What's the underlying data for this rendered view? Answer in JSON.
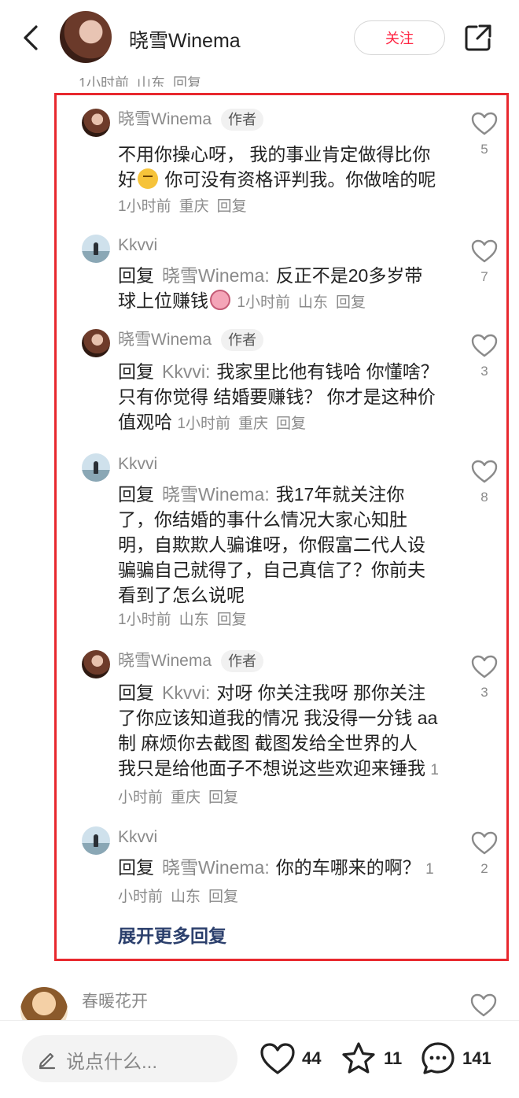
{
  "header": {
    "back_icon": "chevron-left-icon",
    "user_name": "晓雪Winema",
    "follow_label": "关注",
    "share_icon": "share-icon"
  },
  "previous_comment_meta": {
    "time": "1小时前",
    "location": "山东",
    "reply": "回复"
  },
  "replies": [
    {
      "name": "晓雪Winema",
      "tag": "作者",
      "prefix": "",
      "target": "",
      "text": "不用你操心呀， 我的事业肯定做得比你好",
      "emoji": "thinking-face-icon",
      "text_after": " 你可没有资格评判我。你做啥的呢",
      "time": "1小时前",
      "location": "重庆",
      "reply": "回复",
      "likes": "5"
    },
    {
      "name": "Kkvvi",
      "tag": "",
      "prefix": "回复",
      "target": "晓雪Winema",
      "text": "反正不是20多岁带球上位赚钱",
      "emoji": "sweat-face-icon",
      "text_after": "",
      "time": "1小时前",
      "location": "山东",
      "reply": "回复",
      "likes": "7"
    },
    {
      "name": "晓雪Winema",
      "tag": "作者",
      "prefix": "回复",
      "target": "Kkvvi",
      "text": "我家里比他有钱哈 你懂啥？ 只有你觉得 结婚要赚钱？ 你才是这种价值观哈",
      "emoji": "",
      "text_after": "",
      "time": "1小时前",
      "location": "重庆",
      "reply": "回复",
      "likes": "3"
    },
    {
      "name": "Kkvvi",
      "tag": "",
      "prefix": "回复",
      "target": "晓雪Winema",
      "text": "我17年就关注你了，你结婚的事什么情况大家心知肚明，自欺欺人骗谁呀，你假富二代人设骗骗自己就得了，自己真信了？你前夫看到了怎么说呢",
      "emoji": "",
      "text_after": "",
      "time": "1小时前",
      "location": "山东",
      "reply": "回复",
      "likes": "8"
    },
    {
      "name": "晓雪Winema",
      "tag": "作者",
      "prefix": "回复",
      "target": "Kkvvi",
      "text": "对呀 你关注我呀 那你关注了你应该知道我的情况 我没得一分钱 aa制 麻烦你去截图 截图发给全世界的人 我只是给他面子不想说这些欢迎来锤我",
      "emoji": "",
      "text_after": "",
      "time": "1小时前",
      "location": "重庆",
      "reply": "回复",
      "likes": "3"
    },
    {
      "name": "Kkvvi",
      "tag": "",
      "prefix": "回复",
      "target": "晓雪Winema",
      "text": "你的车哪来的啊？",
      "emoji": "",
      "text_after": "",
      "time": "1小时前",
      "location": "山东",
      "reply": "回复",
      "likes": "2"
    }
  ],
  "expand_label": "展开更多回复",
  "next_comment": {
    "name": "春暖花开"
  },
  "bottom_bar": {
    "placeholder": "说点什么...",
    "likes": "44",
    "stars": "11",
    "comments": "141"
  },
  "colors": {
    "accent": "#ff2442",
    "highlight_box": "#e8282e",
    "link": "#2b3f6c"
  }
}
